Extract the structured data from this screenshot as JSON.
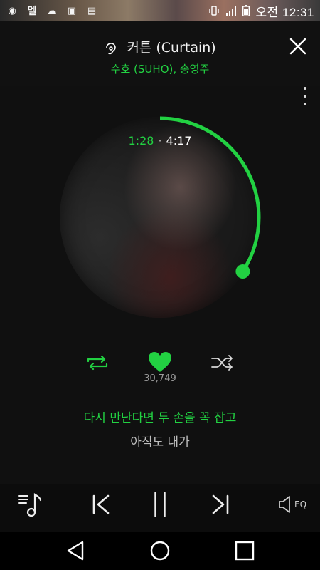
{
  "status_bar": {
    "left_icons": [
      "notification-icon",
      "melon-app-icon",
      "cloud-icon",
      "image-icon",
      "gallery-icon"
    ],
    "left_glyphs": [
      "◉",
      "멜",
      "☁",
      "▣",
      "▤"
    ],
    "right_icons": [
      "vibrate-icon",
      "signal-icon",
      "battery-icon"
    ],
    "time": "오전 12:31"
  },
  "header": {
    "title": "커튼 (Curtain)",
    "artist": "수호 (SUHO), 송영주"
  },
  "player": {
    "current_time": "1:28",
    "total_time": "4:17",
    "progress": 0.342,
    "like_count": "30,749",
    "accent_color": "#22d142"
  },
  "lyrics": {
    "current": "다시 만난다면 두 손을 꼭 잡고",
    "next": "아직도 내가"
  },
  "controls": {
    "eq_label": "EQ"
  }
}
